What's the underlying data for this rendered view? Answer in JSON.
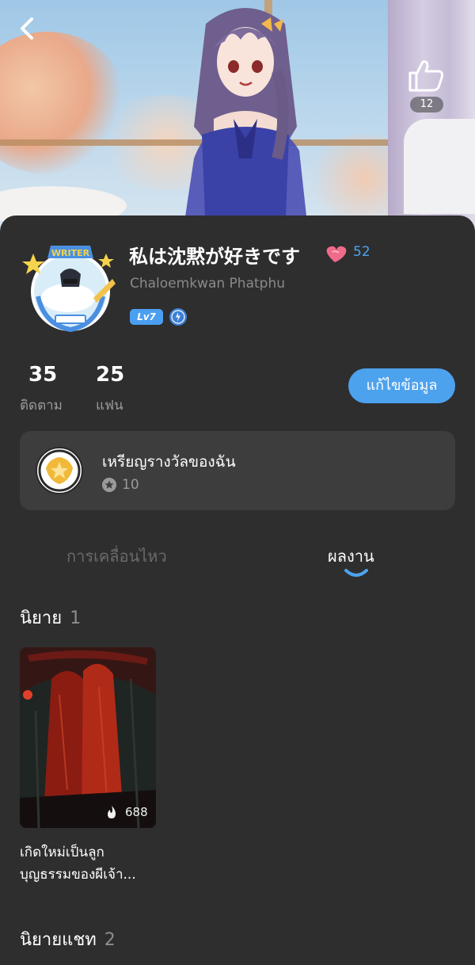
{
  "header": {
    "like_count": "12"
  },
  "profile": {
    "username": "私は沈黙が好きです",
    "heart_count": "52",
    "real_name": "Chaloemkwan Phatphu",
    "level": "Lv7",
    "avatar_badge_text": "WRITER"
  },
  "stats": {
    "following_count": "35",
    "following_label": "ติดตาม",
    "fans_count": "25",
    "fans_label": "แฟน"
  },
  "edit_button": "แก้ไขข้อมูล",
  "medals": {
    "title": "เหรียญรางวัลของฉัน",
    "count": "10"
  },
  "tabs": [
    {
      "label": "การเคลื่อนไหว",
      "active": false
    },
    {
      "label": "ผลงาน",
      "active": true
    }
  ],
  "sections": {
    "novels": {
      "label": "นิยาย",
      "count": "1"
    },
    "chat_novels": {
      "label": "นิยายแชท",
      "count": "2"
    }
  },
  "books": [
    {
      "title": "เกิดใหม่เป็นลูกบุญธรรมของผีเจ้า...",
      "title_line1": "เกิดใหม่เป็นลูก",
      "title_line2": "บุญธรรมของผีเจ้า...",
      "views": "688"
    }
  ],
  "colors": {
    "background": "#2e2e2e",
    "accent_blue": "#4da2ee",
    "card": "#3d3d3d",
    "muted_text": "#9a9a9a"
  }
}
